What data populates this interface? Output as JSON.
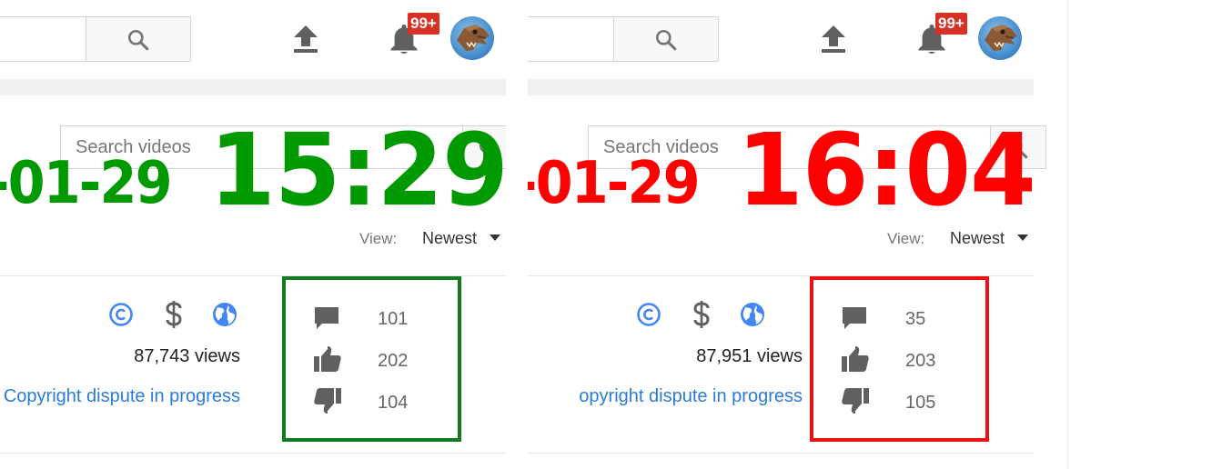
{
  "panels": [
    {
      "header": {
        "notification_badge": "99+"
      },
      "channel_search": {
        "placeholder": "Search videos"
      },
      "overlay": {
        "date": "-01-29",
        "time": "15:29",
        "color": "#009900"
      },
      "sort": {
        "label": "View:",
        "value": "Newest"
      },
      "video": {
        "views": "87,743 views",
        "status_link": "Copyright dispute in progress"
      },
      "stats": {
        "box_color": "#137b1f",
        "comments": "101",
        "likes": "202",
        "dislikes": "104"
      }
    },
    {
      "header": {
        "notification_badge": "99+"
      },
      "channel_search": {
        "placeholder": "Search videos"
      },
      "overlay": {
        "date": "-01-29",
        "time": "16:04",
        "color": "#ff0000"
      },
      "sort": {
        "label": "View:",
        "value": "Newest"
      },
      "video": {
        "views": "87,951 views",
        "status_link": "opyright dispute in progress"
      },
      "stats": {
        "box_color": "#ee1111",
        "comments": "35",
        "likes": "203",
        "dislikes": "105"
      }
    }
  ],
  "icons": [
    "search-icon",
    "upload-icon",
    "bell-icon",
    "copyright-icon",
    "dollar-icon",
    "globe-icon",
    "comment-icon",
    "thumbs-up-icon",
    "thumbs-down-icon"
  ],
  "colors": {
    "link_blue": "#2a7bd6",
    "icon_gray": "#606060",
    "badge_red": "#d93025"
  }
}
